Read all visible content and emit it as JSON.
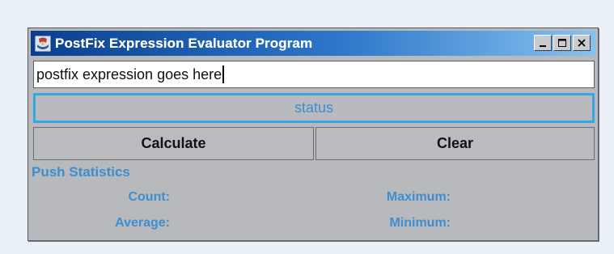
{
  "window": {
    "title": "PostFix Expression Evaluator Program",
    "app_icon": "java-app-icon",
    "controls": {
      "minimize_icon": "minimize-icon",
      "maximize_icon": "maximize-icon",
      "close_icon": "close-icon"
    }
  },
  "expression_input": {
    "value": "postfix expression goes here"
  },
  "status": {
    "text": "status"
  },
  "buttons": {
    "calculate_label": "Calculate",
    "clear_label": "Clear"
  },
  "push_statistics": {
    "heading": "Push Statistics",
    "count_label": "Count:",
    "average_label": "Average:",
    "maximum_label": "Maximum:",
    "minimum_label": "Minimum:"
  },
  "colors": {
    "accent_text": "#3c8ed0",
    "status_border": "#38a6e2",
    "window_background": "#b7b9bc"
  }
}
